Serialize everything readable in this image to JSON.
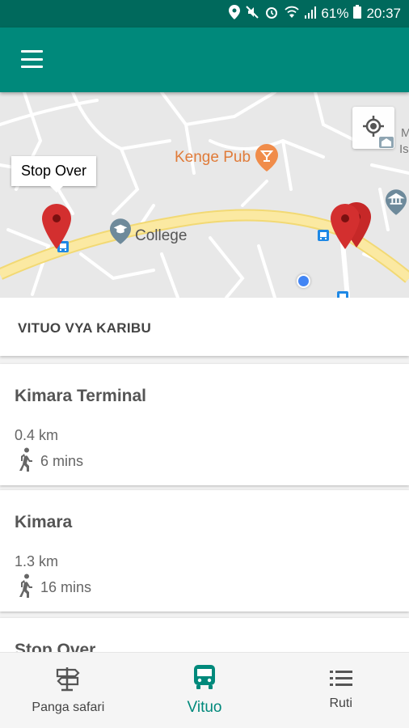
{
  "status_bar": {
    "battery": "61%",
    "time": "20:37"
  },
  "map": {
    "poi": {
      "kenge_pub": "Kenge Pub",
      "college": "College",
      "partial_label_1": "M",
      "partial_label_2": "Is"
    },
    "callout": "Stop Over",
    "colors": {
      "road": "#f9e79f",
      "pin": "#d32f2f",
      "user": "#4285f4",
      "poi_orange": "#e07b39",
      "poi_gray": "#6e8a9b"
    }
  },
  "list": {
    "header": "VITUO VYA KARIBU",
    "stops": [
      {
        "name": "Kimara Terminal",
        "distance": "0.4 km",
        "walk_time": "6 mins"
      },
      {
        "name": "Kimara",
        "distance": "1.3 km",
        "walk_time": "16 mins"
      },
      {
        "name": "Stop Over"
      }
    ]
  },
  "bottom_nav": {
    "items": [
      {
        "label": "Panga safari",
        "icon": "signpost-icon"
      },
      {
        "label": "Vituo",
        "icon": "bus-icon"
      },
      {
        "label": "Ruti",
        "icon": "list-icon"
      }
    ]
  },
  "theme": {
    "primary": "#00897b",
    "primary_dark": "#00695c"
  }
}
